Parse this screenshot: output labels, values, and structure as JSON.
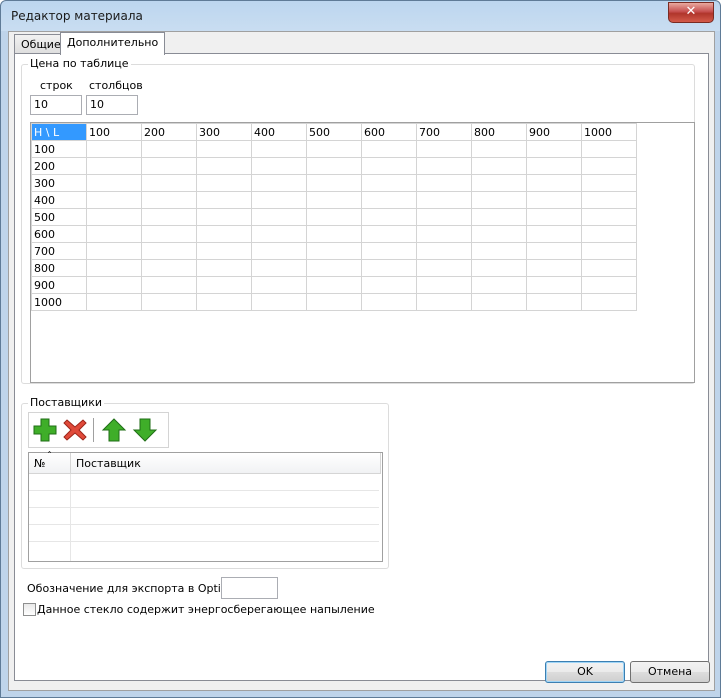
{
  "window": {
    "title": "Редактор материала",
    "close_glyph": "✕"
  },
  "tabs": [
    {
      "label": "Общие",
      "active": false
    },
    {
      "label": "Дополнительно",
      "active": true
    }
  ],
  "price_table": {
    "group_label": "Цена по таблице",
    "rows_label": "строк",
    "cols_label": "столбцов",
    "rows_value": "10",
    "cols_value": "10",
    "corner": "H  \\  L",
    "columns": [
      "100",
      "200",
      "300",
      "400",
      "500",
      "600",
      "700",
      "800",
      "900",
      "1000"
    ],
    "rows": [
      "100",
      "200",
      "300",
      "400",
      "500",
      "600",
      "700",
      "800",
      "900",
      "1000"
    ]
  },
  "suppliers": {
    "group_label": "Поставщики",
    "toolbar": {
      "add_icon": "add-icon",
      "delete_icon": "delete-icon",
      "up_icon": "arrow-up-icon",
      "down_icon": "arrow-down-icon"
    },
    "col_number": "№",
    "col_supplier": "Поставщик",
    "sort_glyph": "ˆ"
  },
  "export_label": "Обозначение для экспорта в OptiWay",
  "export_value": "",
  "energy_checkbox": {
    "label": "Данное стекло содержит энергосберегающее напыление",
    "checked": false
  },
  "buttons": {
    "ok": "OK",
    "cancel": "Отмена"
  },
  "colors": {
    "selection": "#3399ff",
    "add_green": "#3fae29",
    "delete_red": "#e04a3a"
  }
}
